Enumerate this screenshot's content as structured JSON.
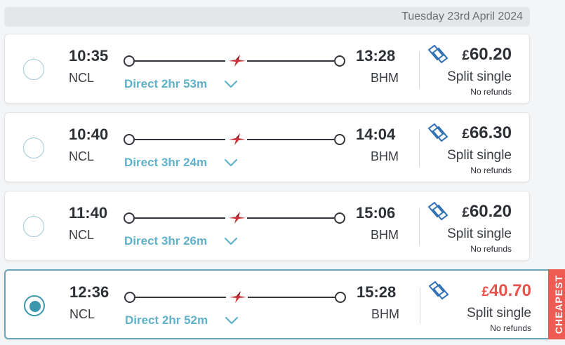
{
  "header": {
    "date_label": "Tuesday 23rd April 2024"
  },
  "journeys": [
    {
      "depart_time": "10:35",
      "depart_station": "NCL",
      "arrive_time": "13:28",
      "arrive_station": "BHM",
      "duration": "Direct 2hr 53m",
      "price_currency": "£",
      "price_amount": "60.20",
      "fare_type": "Split single",
      "refund_note": "No refunds",
      "selected": false,
      "cheapest": false
    },
    {
      "depart_time": "10:40",
      "depart_station": "NCL",
      "arrive_time": "14:04",
      "arrive_station": "BHM",
      "duration": "Direct 3hr 24m",
      "price_currency": "£",
      "price_amount": "66.30",
      "fare_type": "Split single",
      "refund_note": "No refunds",
      "selected": false,
      "cheapest": false
    },
    {
      "depart_time": "11:40",
      "depart_station": "NCL",
      "arrive_time": "15:06",
      "arrive_station": "BHM",
      "duration": "Direct 3hr 26m",
      "price_currency": "£",
      "price_amount": "60.20",
      "fare_type": "Split single",
      "refund_note": "No refunds",
      "selected": false,
      "cheapest": false
    },
    {
      "depart_time": "12:36",
      "depart_station": "NCL",
      "arrive_time": "15:28",
      "arrive_station": "BHM",
      "duration": "Direct 2hr 52m",
      "price_currency": "£",
      "price_amount": "40.70",
      "fare_type": "Split single",
      "refund_note": "No refunds",
      "selected": true,
      "cheapest": true,
      "cheapest_label": "CHEAPEST"
    }
  ],
  "icons": {
    "operator": "crosscountry-operator-icon",
    "ticket": "split-ticket-icon",
    "expand": "chevron-down-icon"
  },
  "colors": {
    "accent": "#3b97ad",
    "duration_text": "#5fb1c9",
    "cheapest": "#ee5b52",
    "cheapest_price": "#e8524d",
    "operator_red": "#c8323a"
  }
}
